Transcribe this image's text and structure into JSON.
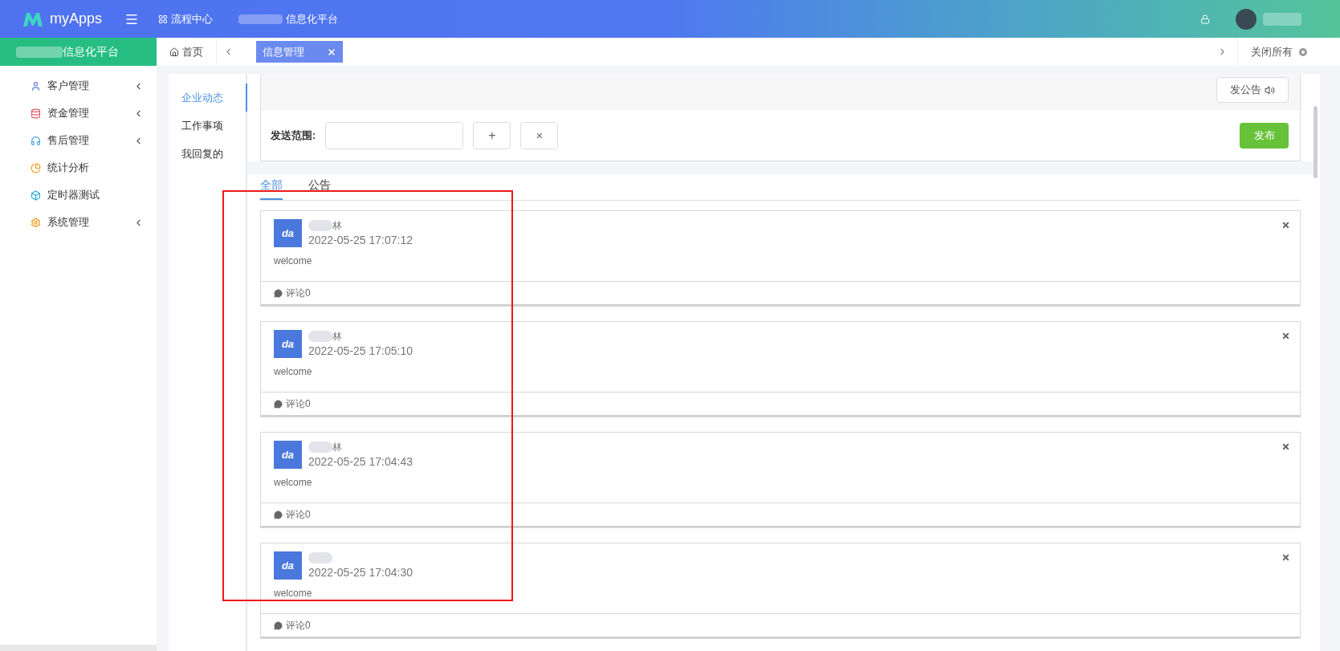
{
  "header": {
    "logo": "myApps",
    "nav": [
      {
        "label": "流程中心"
      },
      {
        "label": "信息化平台"
      }
    ]
  },
  "sidebar": {
    "title": "信息化平台",
    "items": [
      {
        "label": "客户管理",
        "kind": "user",
        "expandable": true
      },
      {
        "label": "资金管理",
        "kind": "database",
        "expandable": true
      },
      {
        "label": "售后管理",
        "kind": "headset",
        "expandable": true
      },
      {
        "label": "统计分析",
        "kind": "pie",
        "expandable": false
      },
      {
        "label": "定时器测试",
        "kind": "cube",
        "expandable": false
      },
      {
        "label": "系统管理",
        "kind": "gear",
        "expandable": true
      }
    ]
  },
  "tabbar": {
    "home": "首页",
    "tabs": [
      {
        "label": "信息管理",
        "selected": true
      }
    ],
    "close_all": "关闭所有"
  },
  "left_nav": [
    {
      "label": "企业动态",
      "selected": true
    },
    {
      "label": "工作事项",
      "selected": false
    },
    {
      "label": "我回复的",
      "selected": false
    }
  ],
  "composer": {
    "announce_button": "发公告",
    "scope_label": "发送范围:",
    "add": "+",
    "clear": "×",
    "publish": "发布"
  },
  "feed_tabs": [
    {
      "label": "全部",
      "selected": true
    },
    {
      "label": "公告",
      "selected": false
    }
  ],
  "posts": [
    {
      "avatar": "da",
      "author": "林",
      "time": "2022-05-25 17:07:12",
      "body": "welcome",
      "comments": "评论0"
    },
    {
      "avatar": "da",
      "author": "林",
      "time": "2022-05-25 17:05:10",
      "body": "welcome",
      "comments": "评论0"
    },
    {
      "avatar": "da",
      "author": "林",
      "time": "2022-05-25 17:04:43",
      "body": "welcome",
      "comments": "评论0"
    },
    {
      "avatar": "da",
      "time": "2022-05-25 17:04:30",
      "body": "welcome",
      "comments": "评论0"
    }
  ]
}
